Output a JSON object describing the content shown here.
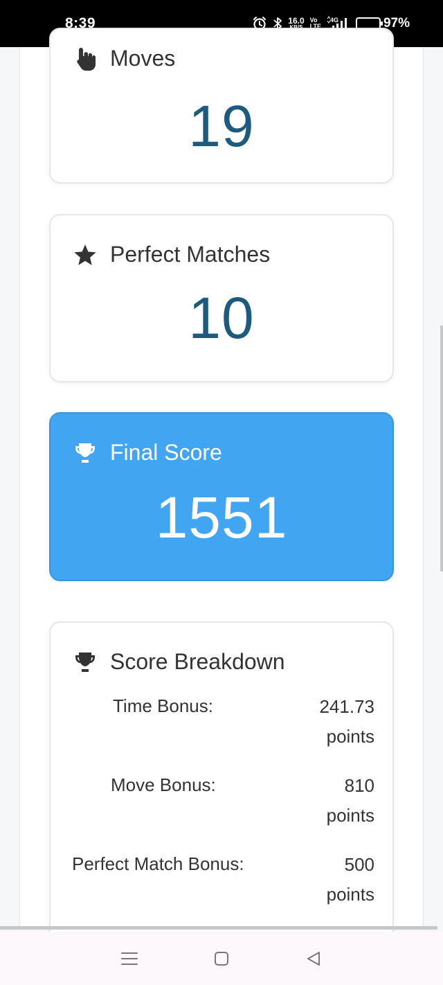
{
  "status_bar": {
    "time": "8:39",
    "net_speed_value": "16.0",
    "net_speed_unit": "KB/S",
    "volte_top": "Vo",
    "volte_bottom": "LTE",
    "network": "4G",
    "battery_percent": "97%",
    "battery_level": 0.97
  },
  "cards": {
    "moves": {
      "title": "Moves",
      "value": "19",
      "icon": "pointer-hand-icon"
    },
    "perfect": {
      "title": "Perfect Matches",
      "value": "10",
      "icon": "star-icon"
    },
    "final": {
      "title": "Final Score",
      "value": "1551",
      "icon": "trophy-icon"
    },
    "breakdown": {
      "title": "Score Breakdown",
      "icon": "trophy-icon",
      "rows": [
        {
          "label": "Time Bonus:",
          "value_line1": "241.73",
          "value_line2": "points"
        },
        {
          "label": "Move Bonus:",
          "value_line1": "810",
          "value_line2": "points"
        },
        {
          "label": "Perfect Match Bonus:",
          "value_line1": "500",
          "value_line2": "points"
        }
      ]
    }
  },
  "colors": {
    "accent": "#42a5f2",
    "value_text": "#1d5a80"
  },
  "nav": {
    "menu_icon": "menu-icon",
    "home_icon": "home-square-icon",
    "back_icon": "back-triangle-icon"
  }
}
